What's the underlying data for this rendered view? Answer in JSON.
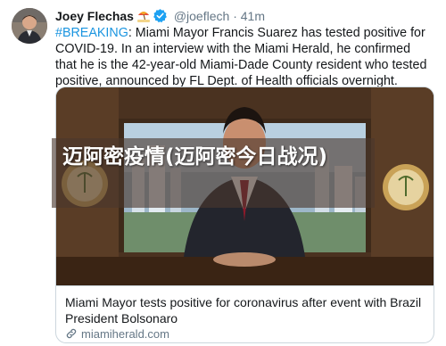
{
  "tweet": {
    "author_name": "Joey Flechas",
    "author_emoji": "beach-umbrella-emoji",
    "verified_icon": "verified-badge-icon",
    "handle": "@joeflech",
    "separator": "·",
    "time": "41m",
    "hashtag": "#BREAKING",
    "text": ": Miami Mayor Francis Suarez has tested positive for COVID-19. In an interview with the Miami Herald, he confirmed that he is the 42-year-old Miami-Dade County resident who tested positive, announced by FL Dept. of Health officials overnight."
  },
  "card": {
    "title": "Miami Mayor tests positive for coronavirus after event with Brazil President Bolsonaro",
    "domain": "miamiherald.com",
    "link_icon": "link-icon"
  },
  "overlay": {
    "text": "迈阿密疫情(迈阿密今日战况)"
  },
  "colors": {
    "link_blue": "#1b95e0",
    "secondary_text": "#657786",
    "border": "#ccd6dd",
    "verified_blue": "#1da1f2"
  }
}
